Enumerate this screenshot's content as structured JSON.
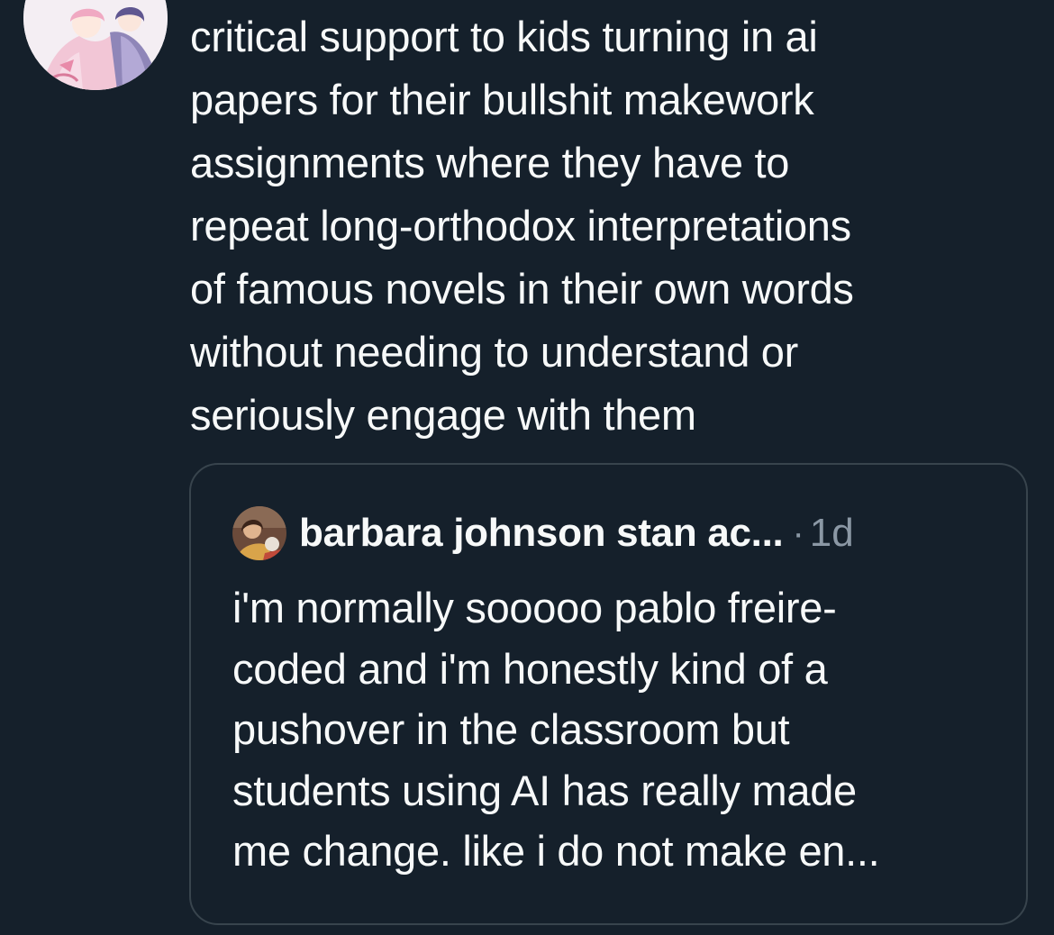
{
  "tweet": {
    "author_avatar_icon": "anime-avatar-icon",
    "text": "critical support to kids turning in ai\npapers for their bullshit makework\nassignments where they have to\nrepeat long-orthodox interpretations\nof famous novels in their own words\nwithout needing to understand or\nseriously engage with them"
  },
  "quoted_tweet": {
    "avatar_icon": "photo-avatar-icon",
    "display_name": "barbara johnson stan ac...",
    "separator": "·",
    "timestamp": "1d",
    "text": "i'm normally sooooo pablo freire-\ncoded and i'm honestly kind of a\npushover in the classroom but\nstudents using AI has really made\nme change. like i do not make en..."
  },
  "theme": {
    "background": "#15202b",
    "text": "#f7f9f9",
    "muted": "#8b98a5",
    "border": "#38444d"
  }
}
